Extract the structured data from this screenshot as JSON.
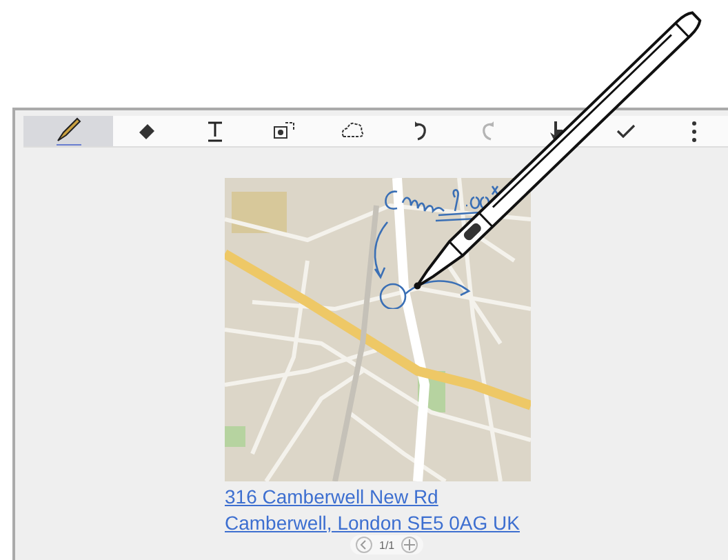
{
  "toolbar": {
    "tools": [
      {
        "kind": "pen",
        "selected": true,
        "disabled": false
      },
      {
        "kind": "eraser",
        "selected": false,
        "disabled": false
      },
      {
        "kind": "text",
        "selected": false,
        "disabled": false
      },
      {
        "kind": "capture",
        "selected": false,
        "disabled": false
      },
      {
        "kind": "lasso",
        "selected": false,
        "disabled": false
      },
      {
        "kind": "undo",
        "selected": false,
        "disabled": false
      },
      {
        "kind": "redo",
        "selected": false,
        "disabled": true
      },
      {
        "kind": "touch",
        "selected": false,
        "disabled": false
      },
      {
        "kind": "done",
        "selected": false,
        "disabled": false
      },
      {
        "kind": "more",
        "selected": false,
        "disabled": false
      }
    ]
  },
  "content": {
    "address_link": "316 Camberwell New Rd Camberwell, London SE5 0AG UK"
  },
  "pager": {
    "page": "1/1"
  }
}
